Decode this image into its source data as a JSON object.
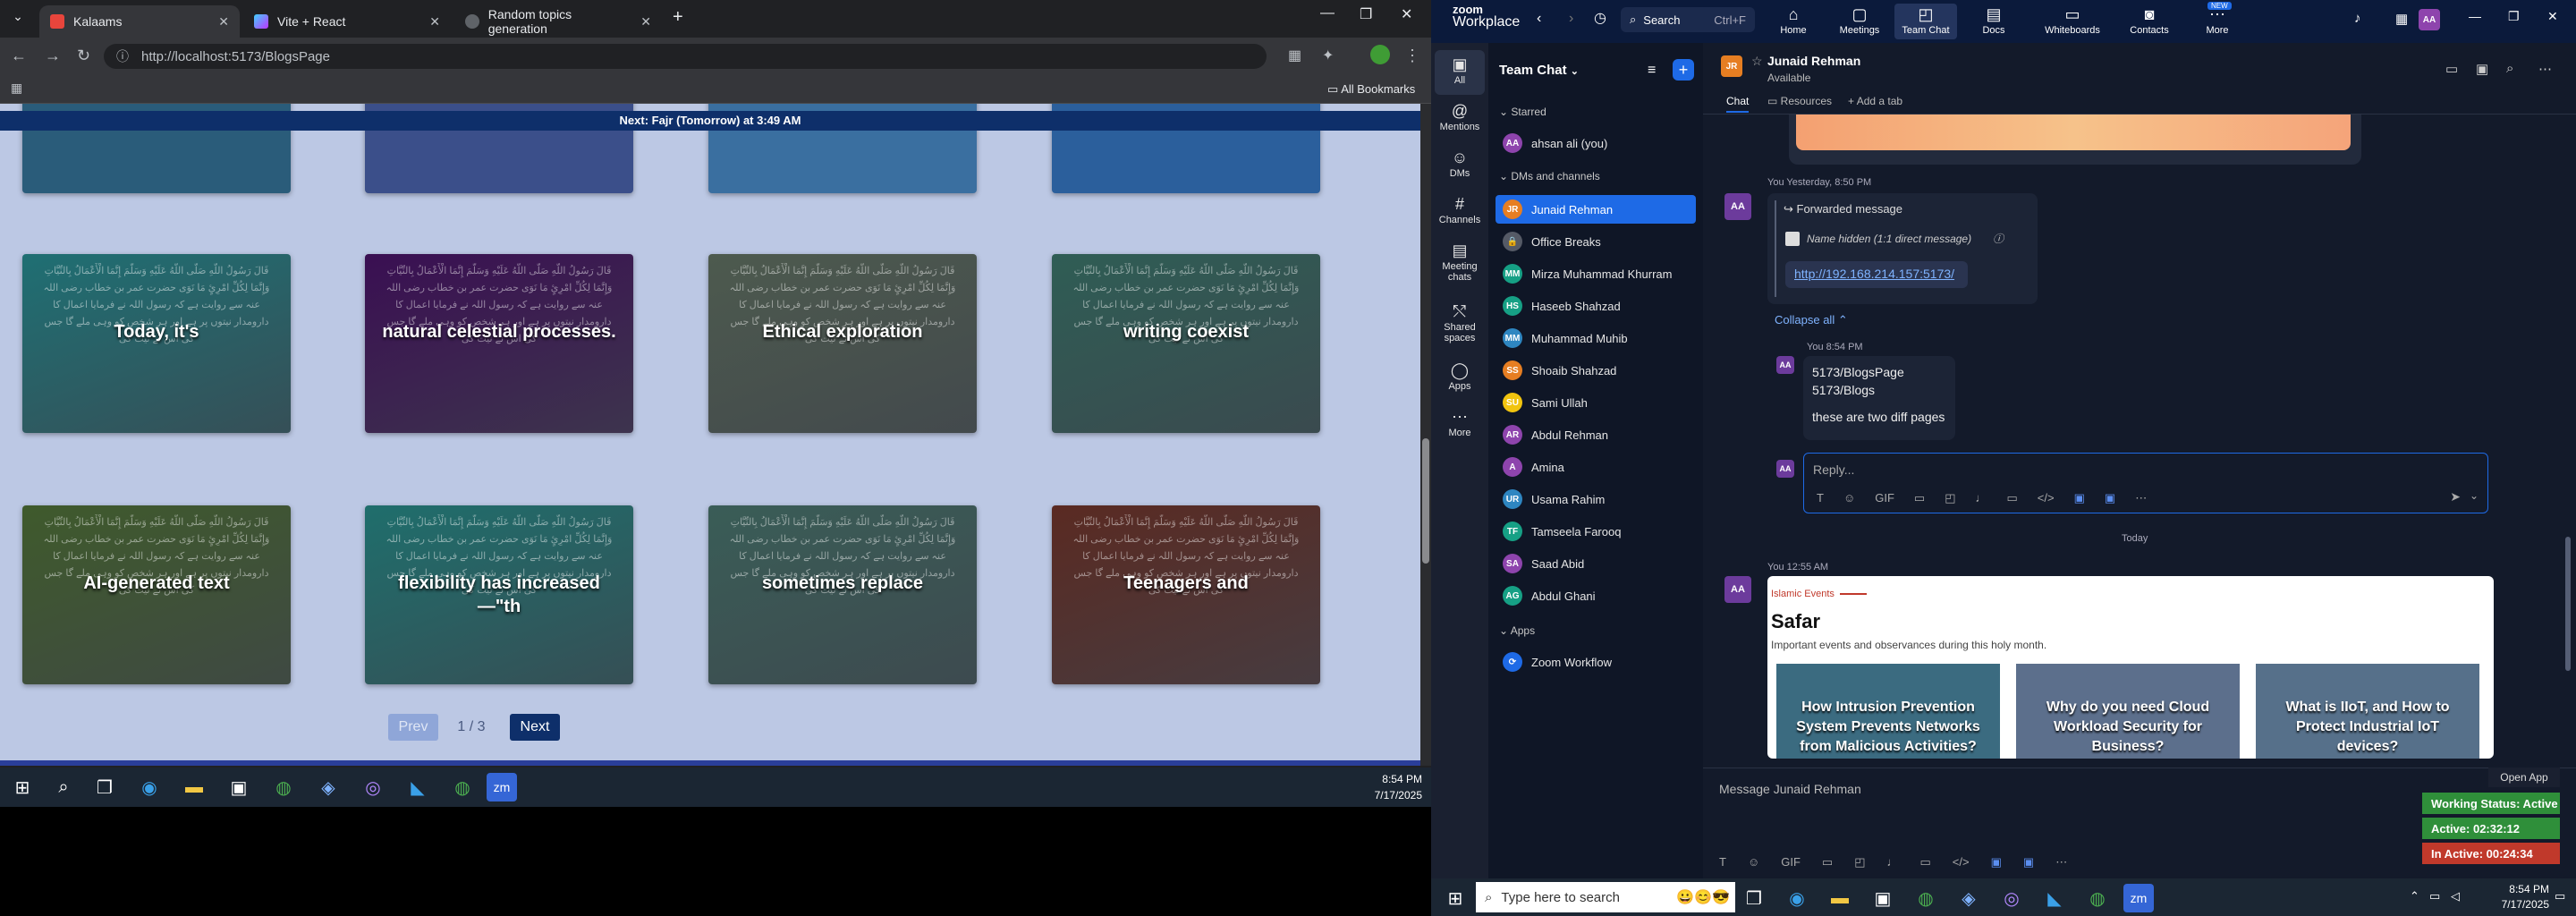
{
  "browser": {
    "tabs": [
      {
        "label": "Kalaams"
      },
      {
        "label": "Vite + React"
      },
      {
        "label": "Random topics generation"
      }
    ],
    "url": "http://localhost:5173/BlogsPage",
    "bookmarks_label": "All Bookmarks"
  },
  "page": {
    "prayer_banner": "Next: Fajr (Tomorrow) at 3:49 AM",
    "cards": [
      {
        "title": "Today, it's",
        "bg": "#1f6f73"
      },
      {
        "title": "natural celestial processes.",
        "bg": "#3a0f52"
      },
      {
        "title": "Ethical exploration",
        "bg": "#4d5a4e"
      },
      {
        "title": "writing coexist",
        "bg": "#2f5d55"
      },
      {
        "title": "AI-generated text",
        "bg": "#3f5a2c"
      },
      {
        "title": "flexibility has increased —\"th",
        "bg": "#1f6e6c"
      },
      {
        "title": "sometimes replace",
        "bg": "#3a5d57"
      },
      {
        "title": "Teenagers and",
        "bg": "#5a2a22"
      }
    ],
    "pagination": {
      "prev": "Prev",
      "indicator": "1 / 3",
      "next": "Next"
    },
    "arabic_filler": "قَالَ رَسُولُ اللَّهِ صَلَّى اللَّهُ عَلَيْهِ وَسَلَّمَ إِنَّمَا الْأَعْمَالُ بِالنِّيَّاتِ وَإِنَّمَا لِكُلِّ امْرِئٍ مَا نَوَى حضرت عمر بن خطاب رضی اللہ عنہ سے روایت ہے کہ رسول اللہ نے فرمایا اعمال کا دارومدار نیتوں پر ہے اور ہر شخص کو وہی ملے گا جس کی اس نے نیت کی"
  },
  "left_taskbar": {
    "time": "8:54 PM",
    "date": "7/17/2025"
  },
  "zoom": {
    "brand_top": "zoom",
    "brand": "Workplace",
    "search": "Search",
    "search_shortcut": "Ctrl+F",
    "nav": [
      {
        "label": "Home",
        "icon": "home-icon"
      },
      {
        "label": "Meetings",
        "icon": "meetings-icon"
      },
      {
        "label": "Team Chat",
        "icon": "chat-icon"
      },
      {
        "label": "Docs",
        "icon": "docs-icon"
      },
      {
        "label": "Whiteboards",
        "icon": "whiteboard-icon"
      },
      {
        "label": "Contacts",
        "icon": "contacts-icon"
      },
      {
        "label": "More",
        "icon": "more-icon"
      }
    ],
    "new_badge": "NEW",
    "left_rail": [
      {
        "label": "All"
      },
      {
        "label": "Mentions"
      },
      {
        "label": "DMs"
      },
      {
        "label": "Channels"
      },
      {
        "label": "Meeting chats"
      },
      {
        "label": "Shared spaces"
      },
      {
        "label": "Apps"
      },
      {
        "label": "More"
      }
    ],
    "panel_title": "Team Chat",
    "starred_label": "Starred",
    "starred": [
      {
        "name": "ahsan ali (you)",
        "initials": "AA",
        "color": "#8e44ad"
      }
    ],
    "dms_label": "DMs and channels",
    "dms": [
      {
        "name": "Junaid Rehman",
        "initials": "JR",
        "color": "#e67e22"
      },
      {
        "name": "Office Breaks",
        "initials": "🔒",
        "color": "#555a66"
      },
      {
        "name": "Mirza Muhammad Khurram",
        "initials": "MM",
        "color": "#16a085"
      },
      {
        "name": "Haseeb Shahzad",
        "initials": "HS",
        "color": "#16a085"
      },
      {
        "name": "Muhammad Muhib",
        "initials": "MM",
        "color": "#2e86c1"
      },
      {
        "name": "Shoaib Shahzad",
        "initials": "SS",
        "color": "#e67e22"
      },
      {
        "name": "Sami Ullah",
        "initials": "SU",
        "color": "#f1c40f"
      },
      {
        "name": "Abdul Rehman",
        "initials": "AR",
        "color": "#8e44ad"
      },
      {
        "name": "Amina",
        "initials": "A",
        "color": "#8e44ad"
      },
      {
        "name": "Usama Rahim",
        "initials": "UR",
        "color": "#2e86c1"
      },
      {
        "name": "Tamseela Farooq",
        "initials": "TF",
        "color": "#16a085"
      },
      {
        "name": "Saad Abid",
        "initials": "SA",
        "color": "#8e44ad"
      },
      {
        "name": "Abdul Ghani",
        "initials": "AG",
        "color": "#16a085"
      }
    ],
    "apps_label": "Apps",
    "apps": [
      {
        "name": "Zoom Workflow"
      }
    ],
    "chat_header": {
      "name": "Junaid Rehman",
      "status": "Available",
      "tabs": [
        "Chat",
        "Resources"
      ],
      "add_tab": "Add a tab"
    },
    "messages": {
      "forward_meta": "You  Yesterday, 8:50 PM",
      "forward_label": "Forwarded message",
      "hidden_name": "Name hidden (1:1 direct message)",
      "link": "http://192.168.214.157:5173/",
      "collapse": "Collapse all",
      "reply_meta": "You  8:54 PM",
      "reply_lines": [
        "5173/BlogsPage",
        "5173/Blogs",
        "",
        "these are two diff pages"
      ],
      "reply_placeholder": "Reply...",
      "day_divider": "Today",
      "post_meta": "You  12:55 AM",
      "post_tag": "Islamic Events",
      "post_title": "Safar",
      "post_desc": "Important events and observances during this holy month.",
      "blog_cards": [
        "How Intrusion Prevention System Prevents Networks from Malicious Activities?",
        "Why do you need Cloud Workload Security for Business?",
        "What is IIoT, and How to Protect Industrial IoT devices?"
      ]
    },
    "composer_placeholder": "Message Junaid Rehman",
    "open_app": "Open App",
    "status_badges": [
      {
        "label": "Working Status: Active",
        "color": "#2f8f3a"
      },
      {
        "label": "Active: 02:32:12",
        "color": "#2f8f3a"
      },
      {
        "label": "In Active: 00:24:34",
        "color": "#c0392b"
      }
    ]
  },
  "right_taskbar": {
    "search_placeholder": "Type here to search",
    "time": "8:54 PM",
    "date": "7/17/2025"
  }
}
